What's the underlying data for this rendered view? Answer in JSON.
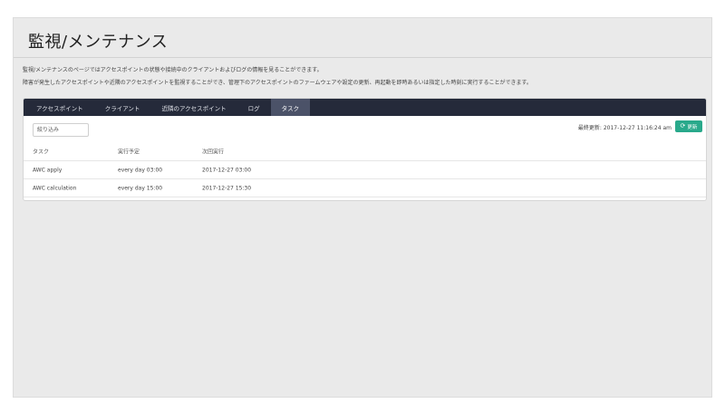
{
  "page": {
    "title": "監視/メンテナンス",
    "description_1": "監視/メンテナンスのページではアクセスポイントの状態や接続中のクライアントおよびログの情報を見ることができます。",
    "description_2": "障害が発生したアクセスポイントや近隣のアクセスポイントを監視することができ、管理下のアクセスポイントのファームウェアや設定の更新、再起動を即時あるいは指定した時刻に実行することができます。"
  },
  "tabs": [
    {
      "label": "アクセスポイント",
      "active": false
    },
    {
      "label": "クライアント",
      "active": false
    },
    {
      "label": "近隣のアクセスポイント",
      "active": false
    },
    {
      "label": "ログ",
      "active": false
    },
    {
      "label": "タスク",
      "active": true
    }
  ],
  "toolbar": {
    "filter_placeholder": "絞り込み",
    "last_updated": "最終更新: 2017-12-27 11:16:24 am",
    "refresh_label": "更新",
    "refresh_icon": "refresh-icon"
  },
  "table": {
    "columns": [
      "タスク",
      "実行予定",
      "次回実行"
    ],
    "rows": [
      [
        "AWC apply",
        "every day 03:00",
        "2017-12-27 03:00"
      ],
      [
        "AWC calculation",
        "every day 15:00",
        "2017-12-27 15:30"
      ]
    ]
  },
  "colors": {
    "tab_bar": "#252a3a",
    "tab_active": "#4b5268",
    "accent": "#29a98b",
    "background": "#eaeaea"
  }
}
